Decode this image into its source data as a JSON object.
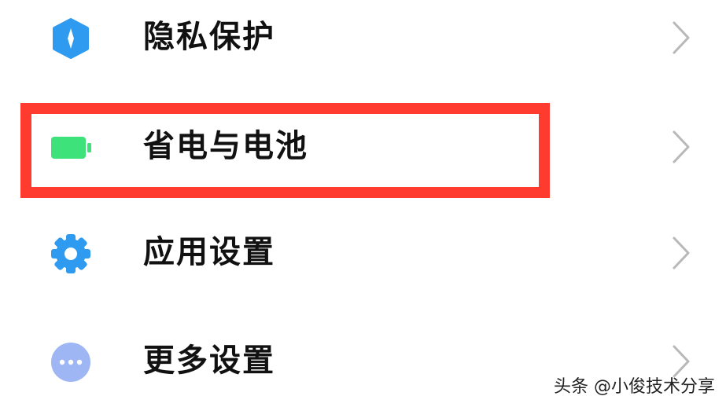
{
  "settings": {
    "items": [
      {
        "label": "隐私保护",
        "icon": "shield-icon"
      },
      {
        "label": "省电与电池",
        "icon": "battery-icon"
      },
      {
        "label": "应用设置",
        "icon": "gear-icon"
      },
      {
        "label": "更多设置",
        "icon": "more-dots-icon"
      }
    ]
  },
  "watermark": {
    "text": "头条 @小俊技术分享"
  },
  "colors": {
    "privacy_icon": "#2f9bf0",
    "battery_icon": "#3ee27a",
    "gear_icon": "#2f9bf0",
    "more_icon": "#9fb6f4",
    "highlight_border": "#ff3b30",
    "chevron": "#b8b8b8"
  }
}
